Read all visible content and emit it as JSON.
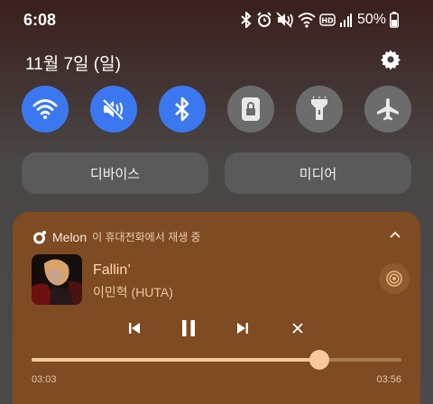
{
  "status_bar": {
    "time": "6:08",
    "battery_percent": "50%",
    "icons": [
      "bluetooth-icon",
      "alarm-icon",
      "mute-icon",
      "wifi-icon",
      "hd-icon",
      "signal-icon",
      "battery-icon"
    ]
  },
  "header": {
    "date": "11월 7일 (일)",
    "settings_icon": "gear-icon"
  },
  "quick_toggles": [
    {
      "name": "wifi",
      "icon": "wifi-icon",
      "on": true
    },
    {
      "name": "mute",
      "icon": "mute-icon",
      "on": true
    },
    {
      "name": "bluetooth",
      "icon": "bluetooth-icon",
      "on": true
    },
    {
      "name": "secure-folder",
      "icon": "lock-icon",
      "on": false
    },
    {
      "name": "flashlight",
      "icon": "flashlight-icon",
      "on": false
    },
    {
      "name": "airplane",
      "icon": "airplane-icon",
      "on": false
    }
  ],
  "panels": {
    "devices_label": "디바이스",
    "media_label": "미디어"
  },
  "media_card": {
    "app_name": "Melon",
    "subtitle": "이 휴대전화에서 재생 중",
    "title": "Fallin’",
    "artist": "이민혁 (HUTA)",
    "elapsed": "03:03",
    "duration": "03:56",
    "progress": 0.777,
    "colors": {
      "card": "#7e4b22",
      "accent": "#f8c99e"
    }
  }
}
